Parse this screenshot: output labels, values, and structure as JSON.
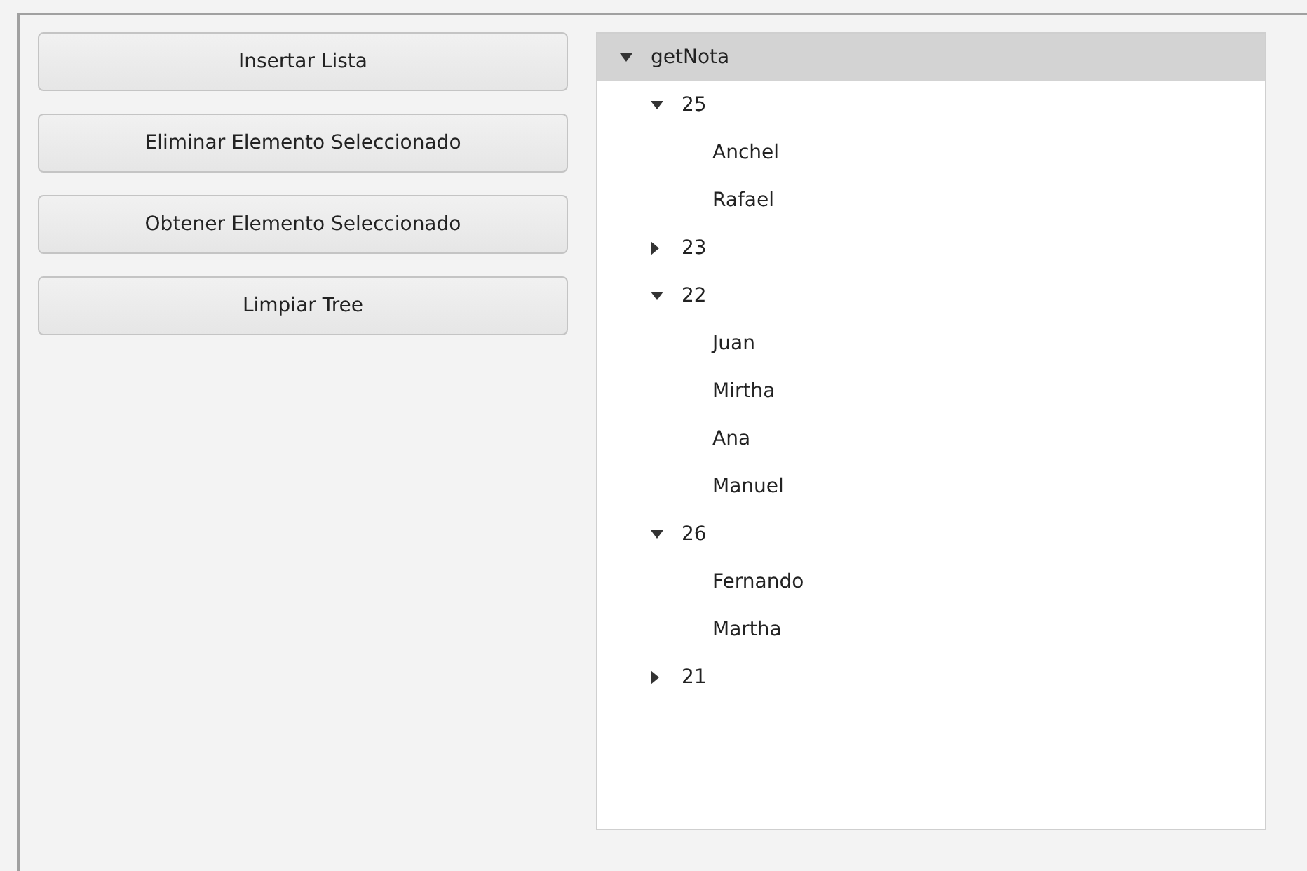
{
  "buttons": [
    {
      "label": "Insertar Lista"
    },
    {
      "label": "Eliminar Elemento Seleccionado"
    },
    {
      "label": "Obtener Elemento Seleccionado"
    },
    {
      "label": "Limpiar Tree"
    }
  ],
  "tree": [
    {
      "label": "getNota",
      "expanded": true,
      "selected": true,
      "children": [
        {
          "label": "25",
          "expanded": true,
          "selected": false,
          "children": [
            {
              "label": "Anchel",
              "selected": false
            },
            {
              "label": "Rafael",
              "selected": false
            }
          ]
        },
        {
          "label": "23",
          "expanded": false,
          "selected": false
        },
        {
          "label": "22",
          "expanded": true,
          "selected": false,
          "children": [
            {
              "label": "Juan",
              "selected": false
            },
            {
              "label": "Mirtha",
              "selected": false
            },
            {
              "label": "Ana",
              "selected": false
            },
            {
              "label": "Manuel",
              "selected": false
            }
          ]
        },
        {
          "label": "26",
          "expanded": true,
          "selected": false,
          "children": [
            {
              "label": "Fernando",
              "selected": false
            },
            {
              "label": "Martha",
              "selected": false
            }
          ]
        },
        {
          "label": "21",
          "expanded": false,
          "selected": false
        }
      ]
    }
  ]
}
